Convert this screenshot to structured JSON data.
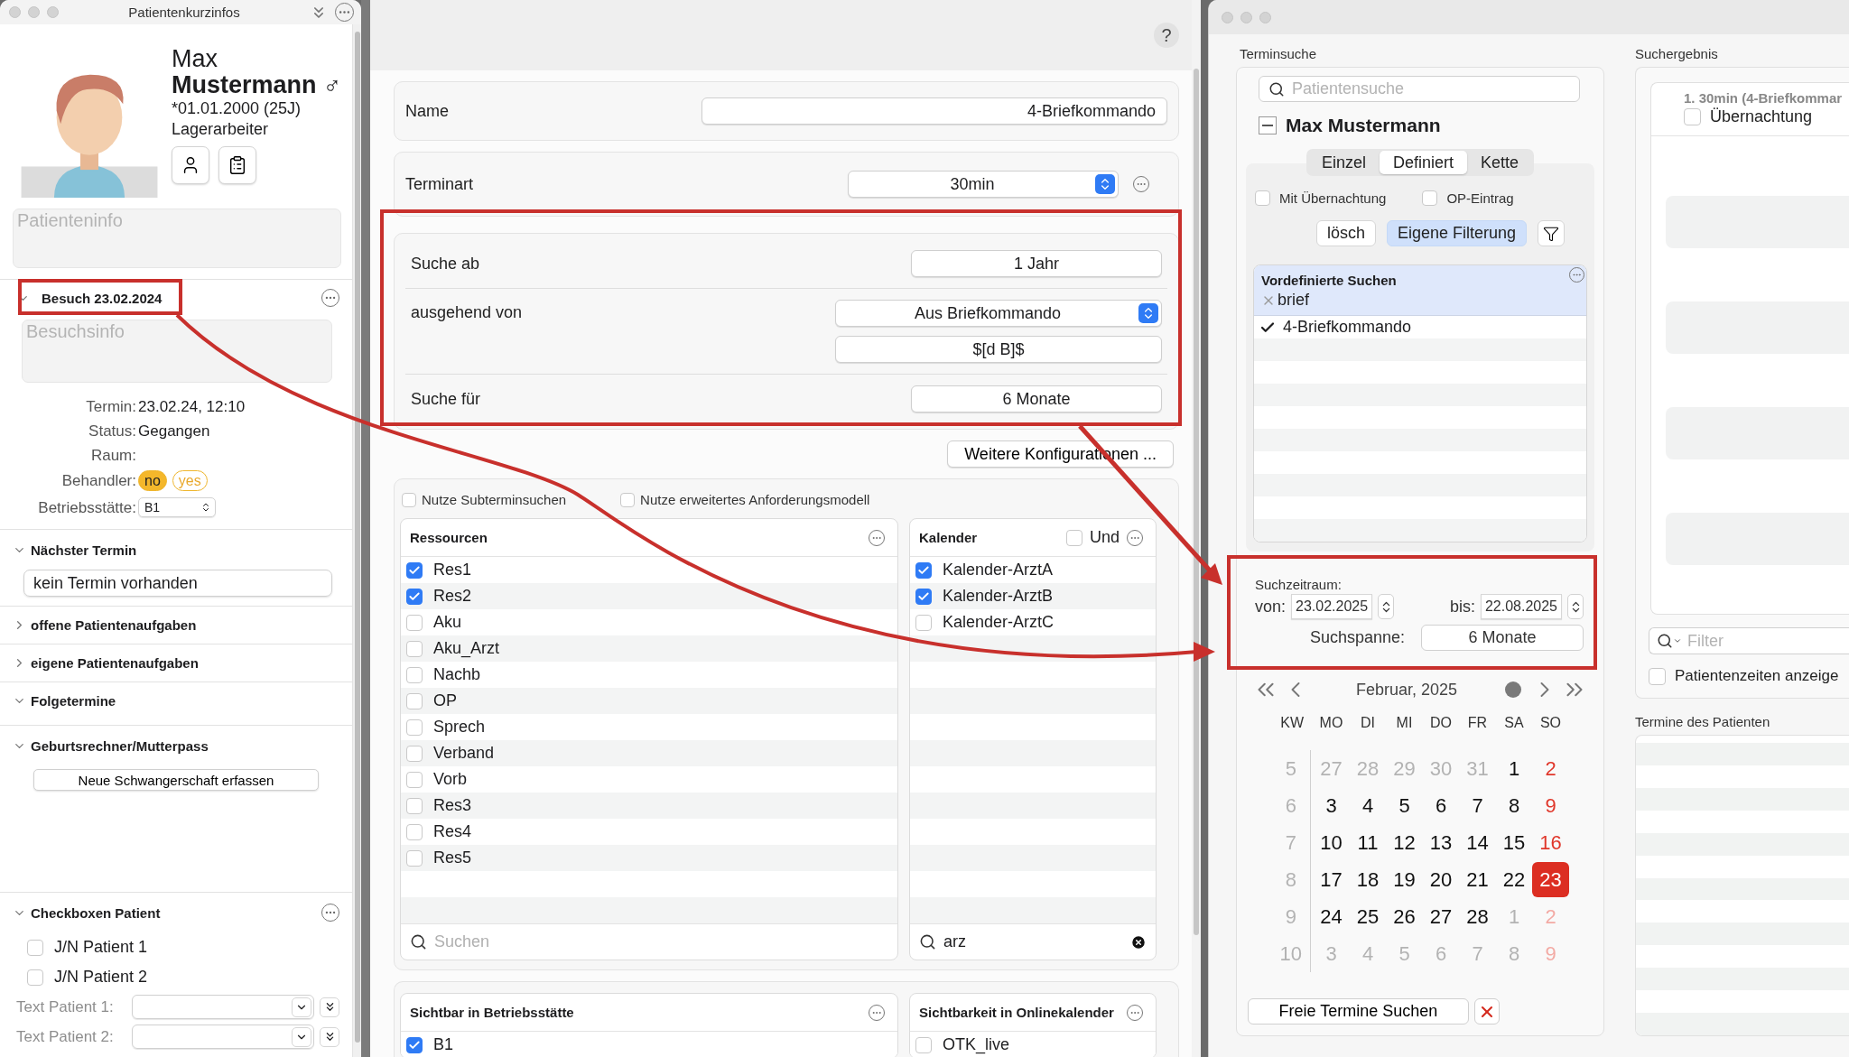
{
  "patient_panel": {
    "title": "Patientenkurzinfos",
    "first_name": "Max",
    "last_name": "Mustermann",
    "gender_symbol": "♂",
    "birth": "*01.01.2000 (25J)",
    "occupation": "Lagerarbeiter",
    "info_placeholder": "Patienteninfo",
    "visit": {
      "title": "Besuch 23.02.2024",
      "expanded": true,
      "info_placeholder": "Besuchsinfo",
      "fields": [
        {
          "label": "Termin:",
          "value": "23.02.24, 12:10"
        },
        {
          "label": "Status:",
          "value": "Gegangen"
        },
        {
          "label": "Raum:"
        }
      ],
      "behandler": {
        "label": "Behandler:",
        "options": [
          {
            "label": "no",
            "selected": true
          },
          {
            "label": "yes",
            "selected": false
          }
        ]
      },
      "site": {
        "label": "Betriebsstätte:",
        "value": "B1"
      }
    },
    "sections": [
      {
        "kind": "field",
        "title": "Nächster Termin",
        "expanded": true,
        "value": "kein Termin vorhanden"
      },
      {
        "kind": "plain",
        "title": "offene Patientenaufgaben",
        "expanded": false
      },
      {
        "kind": "plain",
        "title": "eigene Patientenaufgaben",
        "expanded": false
      },
      {
        "kind": "plain",
        "title": "Folgetermine",
        "expanded": true
      },
      {
        "kind": "button",
        "title": "Geburtsrechner/Mutterpass",
        "expanded": true,
        "button": "Neue Schwangerschaft erfassen"
      },
      {
        "kind": "checkboxes",
        "title": "Checkboxen Patient",
        "expanded": true,
        "checkboxes": [
          {
            "label": "J/N Patient 1",
            "checked": false
          },
          {
            "label": "J/N Patient 2",
            "checked": false
          }
        ],
        "text_fields": [
          {
            "label": "Text Patient 1:"
          },
          {
            "label": "Text Patient 2:"
          }
        ]
      }
    ]
  },
  "appointment_config": {
    "help": "?",
    "name": {
      "label": "Name",
      "value": "4-Briefkommando"
    },
    "type": {
      "label": "Terminart",
      "value": "30min"
    },
    "search_rows": [
      {
        "label": "Suche ab",
        "controls": [
          {
            "kind": "field",
            "value": "1 Jahr"
          }
        ]
      },
      {
        "label": "ausgehend von",
        "controls": [
          {
            "kind": "select",
            "value": "Aus Briefkommando"
          },
          {
            "kind": "field",
            "value": "$[d B]$"
          }
        ]
      },
      {
        "label": "Suche für",
        "controls": [
          {
            "kind": "field",
            "value": "6 Monate"
          }
        ]
      }
    ],
    "more_button": "Weitere Konfigurationen ...",
    "options": [
      {
        "label": "Nutze Subterminsuchen",
        "checked": false
      },
      {
        "label": "Nutze erweitertes Anforderungsmodell",
        "checked": false
      }
    ],
    "lists": [
      {
        "title": "Ressourcen",
        "search": {
          "placeholder": "Suchen"
        },
        "items": [
          {
            "label": "Res1",
            "checked": true
          },
          {
            "label": "Res2",
            "checked": true
          },
          {
            "label": "Aku",
            "checked": false
          },
          {
            "label": "Aku_Arzt",
            "checked": false
          },
          {
            "label": "Nachb",
            "checked": false
          },
          {
            "label": "OP",
            "checked": false
          },
          {
            "label": "Sprech",
            "checked": false
          },
          {
            "label": "Verband",
            "checked": false
          },
          {
            "label": "Vorb",
            "checked": false
          },
          {
            "label": "Res3",
            "checked": false
          },
          {
            "label": "Res4",
            "checked": false
          },
          {
            "label": "Res5",
            "checked": false
          }
        ]
      },
      {
        "title": "Kalender",
        "und": {
          "label": "Und",
          "checked": false
        },
        "search": {
          "value": "arz"
        },
        "items": [
          {
            "label": "Kalender-ArztA",
            "checked": true
          },
          {
            "label": "Kalender-ArztB",
            "checked": true
          },
          {
            "label": "Kalender-ArztC",
            "checked": false
          }
        ]
      }
    ],
    "visibility_lists": [
      {
        "title": "Sichtbar in Betriebsstätte",
        "items": [
          {
            "label": "B1",
            "checked": true
          }
        ]
      },
      {
        "title": "Sichtbarkeit in Onlinekalender",
        "items": [
          {
            "label": "OTK_live",
            "checked": false
          }
        ]
      }
    ]
  },
  "search_window": {
    "terminsuche": {
      "title": "Terminsuche",
      "search_placeholder": "Patientensuche",
      "patient": "Max Mustermann",
      "tabs": [
        {
          "label": "Einzel",
          "selected": false
        },
        {
          "label": "Definiert",
          "selected": true
        },
        {
          "label": "Kette",
          "selected": false
        }
      ],
      "checks": [
        {
          "label": "Mit Übernachtung",
          "checked": false
        },
        {
          "label": "OP-Eintrag",
          "checked": false
        }
      ],
      "buttons": [
        {
          "label": "lösch",
          "selected": false
        },
        {
          "label": "Eigene Filterung",
          "selected": true
        }
      ],
      "predefined": {
        "title": "Vordefinierte Suchen",
        "filter": "brief",
        "items": [
          {
            "label": "4-Briefkommando",
            "checked": true
          }
        ]
      },
      "period": {
        "title": "Suchzeitraum:",
        "from_label": "von:",
        "from": "23.02.2025",
        "to_label": "bis:",
        "to": "22.08.2025",
        "span_label": "Suchspanne:",
        "span": "6 Monate"
      },
      "calendar": {
        "month": "Februar, 2025",
        "headers": [
          "KW",
          "MO",
          "DI",
          "MI",
          "DO",
          "FR",
          "SA",
          "SO"
        ],
        "weeks": [
          {
            "week": "5",
            "days": [
              {
                "day": "27",
                "outside": true,
                "selected": false
              },
              {
                "day": "28",
                "outside": true,
                "selected": false
              },
              {
                "day": "29",
                "outside": true,
                "selected": false
              },
              {
                "day": "30",
                "outside": true,
                "selected": false
              },
              {
                "day": "31",
                "outside": true,
                "selected": false
              },
              {
                "day": "1",
                "outside": false,
                "selected": false
              },
              {
                "day": "2",
                "outside": false,
                "selected": false
              }
            ]
          },
          {
            "week": "6",
            "days": [
              {
                "day": "3",
                "outside": false,
                "selected": false
              },
              {
                "day": "4",
                "outside": false,
                "selected": false
              },
              {
                "day": "5",
                "outside": false,
                "selected": false
              },
              {
                "day": "6",
                "outside": false,
                "selected": false
              },
              {
                "day": "7",
                "outside": false,
                "selected": false
              },
              {
                "day": "8",
                "outside": false,
                "selected": false
              },
              {
                "day": "9",
                "outside": false,
                "selected": false
              }
            ]
          },
          {
            "week": "7",
            "days": [
              {
                "day": "10",
                "outside": false,
                "selected": false
              },
              {
                "day": "11",
                "outside": false,
                "selected": false
              },
              {
                "day": "12",
                "outside": false,
                "selected": false
              },
              {
                "day": "13",
                "outside": false,
                "selected": false
              },
              {
                "day": "14",
                "outside": false,
                "selected": false
              },
              {
                "day": "15",
                "outside": false,
                "selected": false
              },
              {
                "day": "16",
                "outside": false,
                "selected": false
              }
            ]
          },
          {
            "week": "8",
            "days": [
              {
                "day": "17",
                "outside": false,
                "selected": false
              },
              {
                "day": "18",
                "outside": false,
                "selected": false
              },
              {
                "day": "19",
                "outside": false,
                "selected": false
              },
              {
                "day": "20",
                "outside": false,
                "selected": false
              },
              {
                "day": "21",
                "outside": false,
                "selected": false
              },
              {
                "day": "22",
                "outside": false,
                "selected": false
              },
              {
                "day": "23",
                "outside": false,
                "selected": true
              }
            ]
          },
          {
            "week": "9",
            "days": [
              {
                "day": "24",
                "outside": false,
                "selected": false
              },
              {
                "day": "25",
                "outside": false,
                "selected": false
              },
              {
                "day": "26",
                "outside": false,
                "selected": false
              },
              {
                "day": "27",
                "outside": false,
                "selected": false
              },
              {
                "day": "28",
                "outside": false,
                "selected": false
              },
              {
                "day": "1",
                "outside": true,
                "selected": false
              },
              {
                "day": "2",
                "outside": true,
                "selected": false
              }
            ]
          },
          {
            "week": "10",
            "days": [
              {
                "day": "3",
                "outside": true,
                "selected": false
              },
              {
                "day": "4",
                "outside": true,
                "selected": false
              },
              {
                "day": "5",
                "outside": true,
                "selected": false
              },
              {
                "day": "6",
                "outside": true,
                "selected": false
              },
              {
                "day": "7",
                "outside": true,
                "selected": false
              },
              {
                "day": "8",
                "outside": true,
                "selected": false
              },
              {
                "day": "9",
                "outside": true,
                "selected": false
              }
            ]
          }
        ]
      },
      "search_button": "Freie Termine Suchen"
    },
    "results": {
      "title": "Suchergebnis",
      "first_result": {
        "title": "1. 30min (4-Briefkommar",
        "option": {
          "label": "Übernachtung",
          "checked": false
        }
      },
      "filter_placeholder": "Filter",
      "show_times": {
        "label": "Patientenzeiten anzeige",
        "checked": false
      }
    },
    "patient_appointments": {
      "title": "Termine des Patienten"
    }
  }
}
